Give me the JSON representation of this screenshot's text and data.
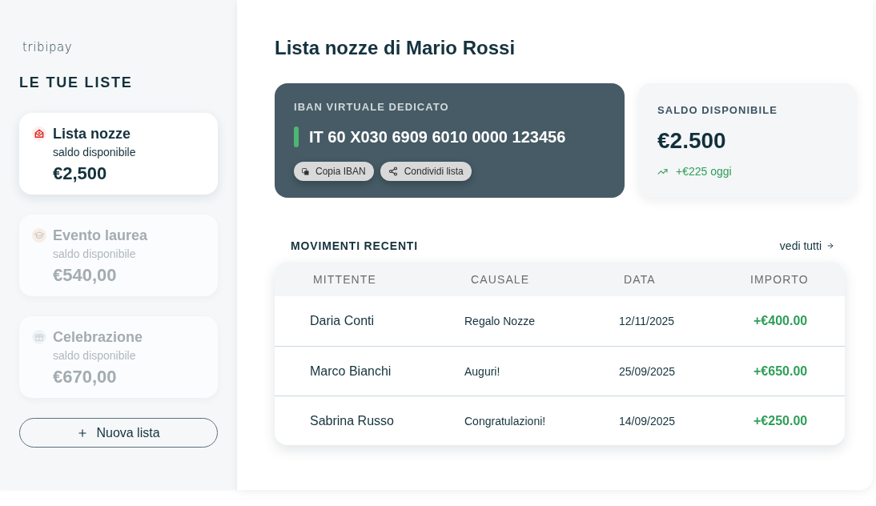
{
  "sidebar": {
    "logo": "tribipay",
    "heading": "LE TUE LISTE",
    "lists": [
      {
        "kind": "wedding",
        "name": "Lista nozze",
        "caption": "saldo disponibile",
        "balance": "€2,500",
        "selected": true
      },
      {
        "kind": "graduation",
        "name": "Evento laurea",
        "caption": "saldo disponibile",
        "balance": "€540,00",
        "selected": false
      },
      {
        "kind": "celebration",
        "name": "Celebrazione",
        "caption": "saldo disponibile",
        "balance": "€670,00",
        "selected": false
      }
    ],
    "new_list_button": "Nuova lista"
  },
  "main": {
    "title": "Lista nozze di Mario Rossi",
    "iban_card": {
      "label": "IBAN VIRTUALE DEDICATO",
      "iban": "IT 60 X030 6909 6010 0000 123456",
      "actions": [
        {
          "kind": "copy",
          "label": "Copia IBAN"
        },
        {
          "kind": "share",
          "label": "Condividi lista"
        }
      ]
    },
    "balance_card": {
      "label": "SALDO DISPONIBILE",
      "amount": "€2.500",
      "change": "+€225 oggi"
    },
    "transactions": {
      "title": "MOVIMENTI RECENTI",
      "link": "vedi tutti",
      "columns": [
        "MITTENTE",
        "CAUSALE",
        "DATA",
        "IMPORTO"
      ],
      "rows": [
        {
          "sender": "Daria Conti",
          "reason": "Regalo Nozze",
          "date": "12/11/2025",
          "amount": "+€400.00"
        },
        {
          "sender": "Marco Bianchi",
          "reason": "Auguri!",
          "date": "25/09/2025",
          "amount": "+€650.00"
        },
        {
          "sender": "Sabrina Russo",
          "reason": "Congratulazioni!",
          "date": "14/09/2025",
          "amount": "+€250.00"
        }
      ]
    }
  }
}
